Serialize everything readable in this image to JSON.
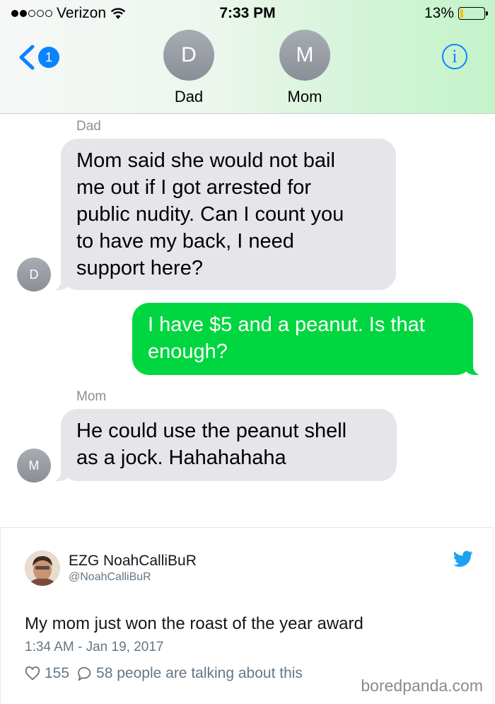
{
  "status_bar": {
    "carrier": "Verizon",
    "signal_bars": 2,
    "time": "7:33 PM",
    "battery_percent": "13%",
    "battery_level": 0.13,
    "battery_color": "#f5c400"
  },
  "header": {
    "back_badge": "1",
    "info_label": "i",
    "contacts": [
      {
        "initial": "D",
        "name": "Dad"
      },
      {
        "initial": "M",
        "name": "Mom"
      }
    ]
  },
  "messages": [
    {
      "sender": "Dad",
      "avatar": "D",
      "type": "received",
      "lines": [
        "Mom said she would not bail",
        "me out if I got arrested for",
        "public nudity. Can I count you",
        "to have my back, I need",
        "support here?"
      ]
    },
    {
      "type": "sent",
      "lines": [
        "I have $5 and a peanut. Is that",
        "enough?"
      ]
    },
    {
      "sender": "Mom",
      "avatar": "M",
      "type": "received",
      "lines": [
        "He could use the peanut shell",
        "as a jock.  Hahahahaha"
      ]
    }
  ],
  "colors": {
    "sent_bubble": "#00d640",
    "received_bubble": "#e5e5ea",
    "ios_blue": "#0a84ff",
    "twitter_blue": "#1da1f2"
  },
  "tweet": {
    "display_name": "EZG NoahCalliBuR",
    "handle": "@NoahCalliBuR",
    "text": "My mom just won the roast of the year award",
    "date": "1:34 AM - Jan 19, 2017",
    "likes": "155",
    "replies_text": "58 people are talking about this",
    "icons": [
      "heart-icon",
      "reply-bubble-icon",
      "twitter-bird-icon"
    ]
  },
  "watermark": "boredpanda.com"
}
